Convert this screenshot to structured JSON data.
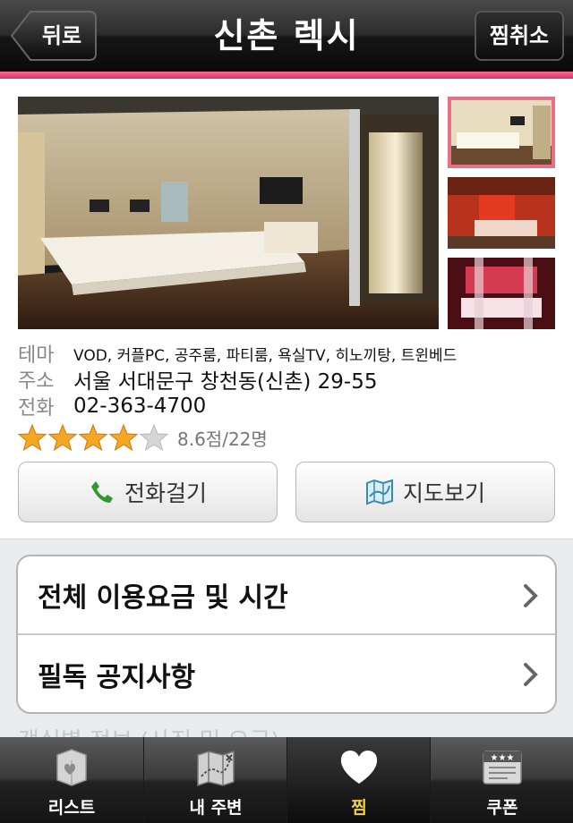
{
  "nav": {
    "back_label": "뒤로",
    "title": "신촌 렉시",
    "unfav_label": "찜취소"
  },
  "info": {
    "theme_label": "테마",
    "theme_value": "VOD, 커플PC, 공주룸, 파티룸, 욕실TV, 히노끼탕, 트윈베드",
    "address_label": "주소",
    "address_value": "서울 서대문구 창천동(신촌) 29-55",
    "phone_label": "전화",
    "phone_value": "02-363-4700"
  },
  "rating": {
    "stars": 4,
    "max_stars": 5,
    "text": "8.6점/22명"
  },
  "actions": {
    "call_label": "전화걸기",
    "map_label": "지도보기"
  },
  "menu": {
    "items": [
      {
        "label": "전체 이용요금 및 시간"
      },
      {
        "label": "필독 공지사항"
      }
    ]
  },
  "peek_text": "객실별 정보 (사진 및 요금)",
  "tabs": [
    {
      "label": "리스트",
      "icon": "list-box-icon"
    },
    {
      "label": "내 주변",
      "icon": "map-icon"
    },
    {
      "label": "찜",
      "icon": "heart-icon",
      "active": true
    },
    {
      "label": "쿠폰",
      "icon": "coupon-icon"
    }
  ],
  "colors": {
    "accent": "#e04070",
    "active_tab": "#f2d23a"
  }
}
